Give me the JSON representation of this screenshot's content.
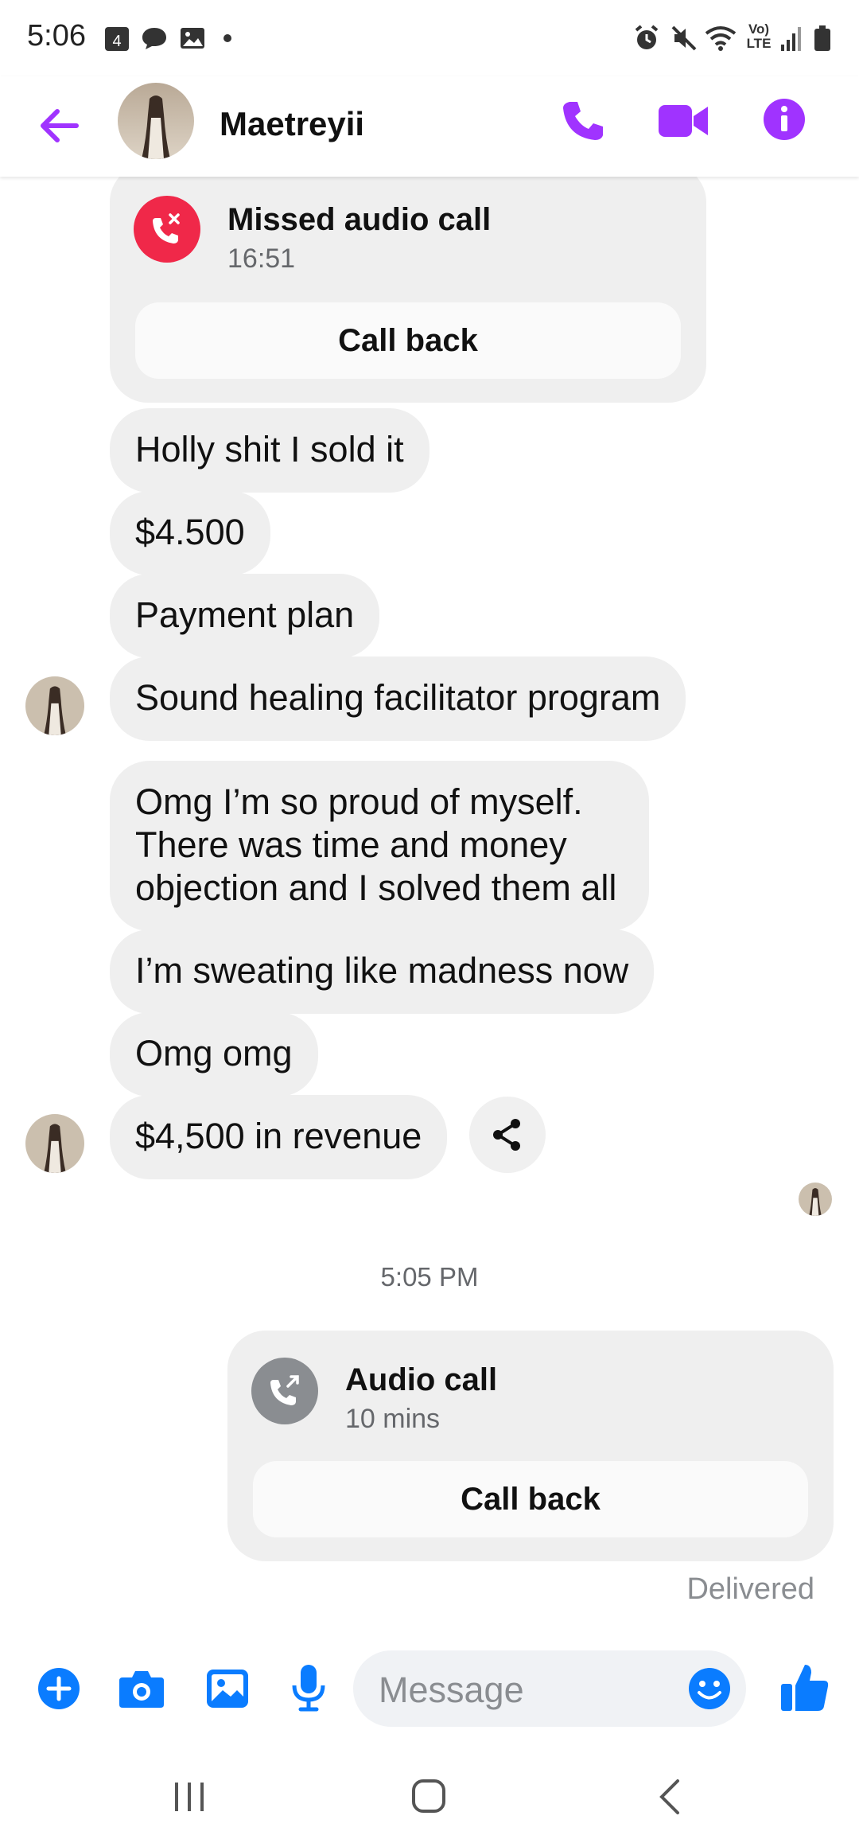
{
  "status_bar": {
    "time": "5:06",
    "notification_badge": "4",
    "network_label": "LTE"
  },
  "header": {
    "contact_name": "Maetreyii"
  },
  "messages": {
    "missed_call": {
      "title": "Missed audio call",
      "time": "16:51",
      "button": "Call back"
    },
    "m1": "Holly shit I sold it",
    "m2": "$4.500",
    "m3": "Payment plan",
    "m4": "Sound healing facilitator program",
    "m5_line1": "Omg I’m so proud of myself.",
    "m5_line2": "There was time and money",
    "m5_line3": "objection and I solved them all",
    "m6": "I’m sweating like madness now",
    "m7": "Omg omg",
    "m8": "$4,500 in revenue",
    "timestamp": "5:05 PM",
    "audio_call": {
      "title": "Audio call",
      "duration": "10 mins",
      "button": "Call back"
    },
    "delivered": "Delivered"
  },
  "composer": {
    "placeholder": "Message"
  },
  "colors": {
    "accent_purple": "#a033ff",
    "messenger_blue": "#0a7cff",
    "missed_red": "#f02849",
    "bubble_gray": "#efefef"
  },
  "icons": {
    "back": "arrow-left-icon",
    "phone": "phone-icon",
    "video": "video-camera-icon",
    "info": "info-icon",
    "share": "share-icon",
    "plus": "plus-icon",
    "camera": "camera-icon",
    "gallery": "image-icon",
    "mic": "microphone-icon",
    "emoji": "emoji-icon",
    "like": "thumbs-up-icon"
  }
}
